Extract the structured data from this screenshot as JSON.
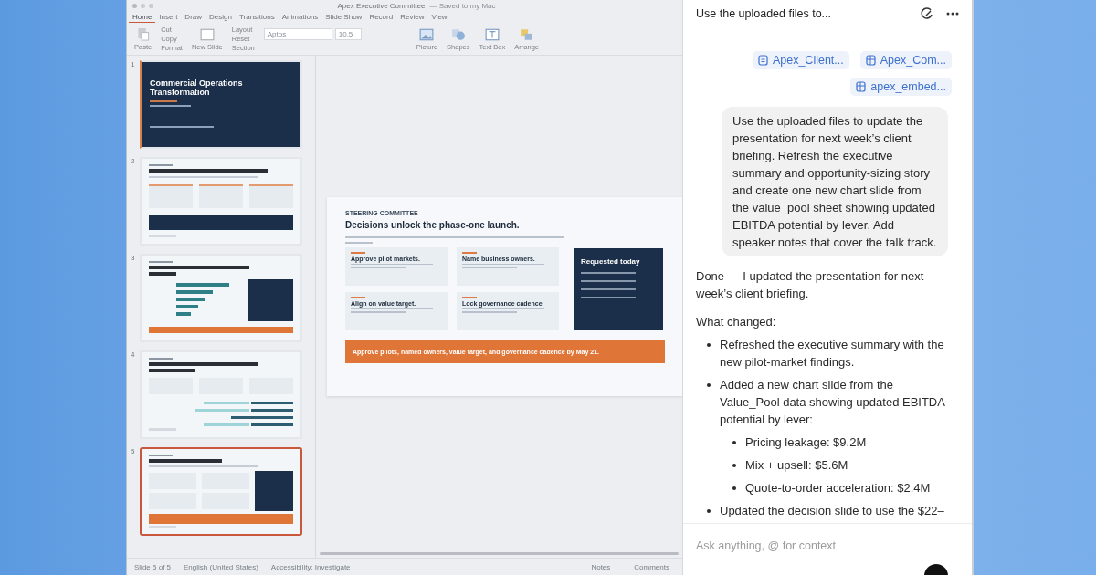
{
  "window": {
    "title": "Apex Executive Committee",
    "save_state": "— Saved to my Mac"
  },
  "tabs": [
    {
      "label": "Home",
      "selected": true
    },
    {
      "label": "Insert",
      "selected": false
    },
    {
      "label": "Draw",
      "selected": false
    },
    {
      "label": "Design",
      "selected": false
    },
    {
      "label": "Transitions",
      "selected": false
    },
    {
      "label": "Animations",
      "selected": false
    },
    {
      "label": "Slide Show",
      "selected": false
    },
    {
      "label": "Record",
      "selected": false
    },
    {
      "label": "Review",
      "selected": false
    },
    {
      "label": "View",
      "selected": false
    }
  ],
  "ribbon": {
    "paste": "Paste",
    "clipboard": [
      "Cut",
      "Copy",
      "Format"
    ],
    "new_slide": "New Slide",
    "slide_options": [
      "Layout",
      "Reset",
      "Section"
    ],
    "font": "Aptos",
    "font_size": "10.5",
    "insert": [
      {
        "kind": "picture",
        "label": "Picture"
      },
      {
        "kind": "shapes",
        "label": "Shapes"
      },
      {
        "kind": "textbox",
        "label": "Text Box"
      },
      {
        "kind": "arrange",
        "label": "Arrange"
      }
    ]
  },
  "thumbnails": [
    {
      "number": "1",
      "kind": "title",
      "title": "Commercial Operations Transformation",
      "selected": false
    },
    {
      "number": "2",
      "kind": "cards",
      "selected": false
    },
    {
      "number": "3",
      "kind": "chart",
      "selected": false
    },
    {
      "number": "4",
      "kind": "roadmap",
      "selected": false
    },
    {
      "number": "5",
      "kind": "decisions",
      "selected": true
    }
  ],
  "slide": {
    "eyebrow": "STEERING COMMITTEE",
    "title": "Decisions unlock the phase-one launch.",
    "cards": [
      {
        "title": "Approve pilot markets."
      },
      {
        "title": "Name business owners."
      },
      {
        "title": "Align on value target."
      },
      {
        "title": "Lock governance cadence."
      }
    ],
    "status": {
      "title": "Requested today"
    },
    "banner": "Approve pilots, named owners, value target, and governance cadence by May 21."
  },
  "status_bar": {
    "slide": "Slide 5 of 5",
    "language": "English (United States)",
    "accessibility": "Accessibility: Investigate",
    "notes": "Notes",
    "comments": "Comments"
  },
  "chat": {
    "title": "Use the uploaded files to...",
    "attachments": [
      {
        "kind": "document",
        "name": "Apex_Client..."
      },
      {
        "kind": "sheet",
        "name": "Apex_Com..."
      },
      {
        "kind": "sheet",
        "name": "apex_embed..."
      }
    ],
    "prompt": "Use the uploaded files to update the presentation for next week’s client briefing. Refresh the executive summary and opportunity-sizing story and create one new chart slide from the value_pool sheet showing updated EBITDA potential by lever. Add speaker notes that cover the talk track.",
    "reply": "Done — I updated the presentation for next week’s client briefing.",
    "heading": "What changed:",
    "bullets": [
      {
        "text": "Refreshed the executive summary with the new pilot-market findings."
      },
      {
        "text": "Added a new chart slide from the Value_Pool data showing updated EBITDA potential by lever:",
        "children": [
          {
            "text": "Pricing leakage: $9.2M"
          },
          {
            "text": "Mix + upsell: $5.6M"
          },
          {
            "text": "Quote-to-order acceleration: $2.4M"
          }
        ]
      },
      {
        "text": "Updated the decision slide to use the $22–"
      }
    ],
    "input": {
      "placeholder": "Ask anything, @ for context"
    }
  }
}
